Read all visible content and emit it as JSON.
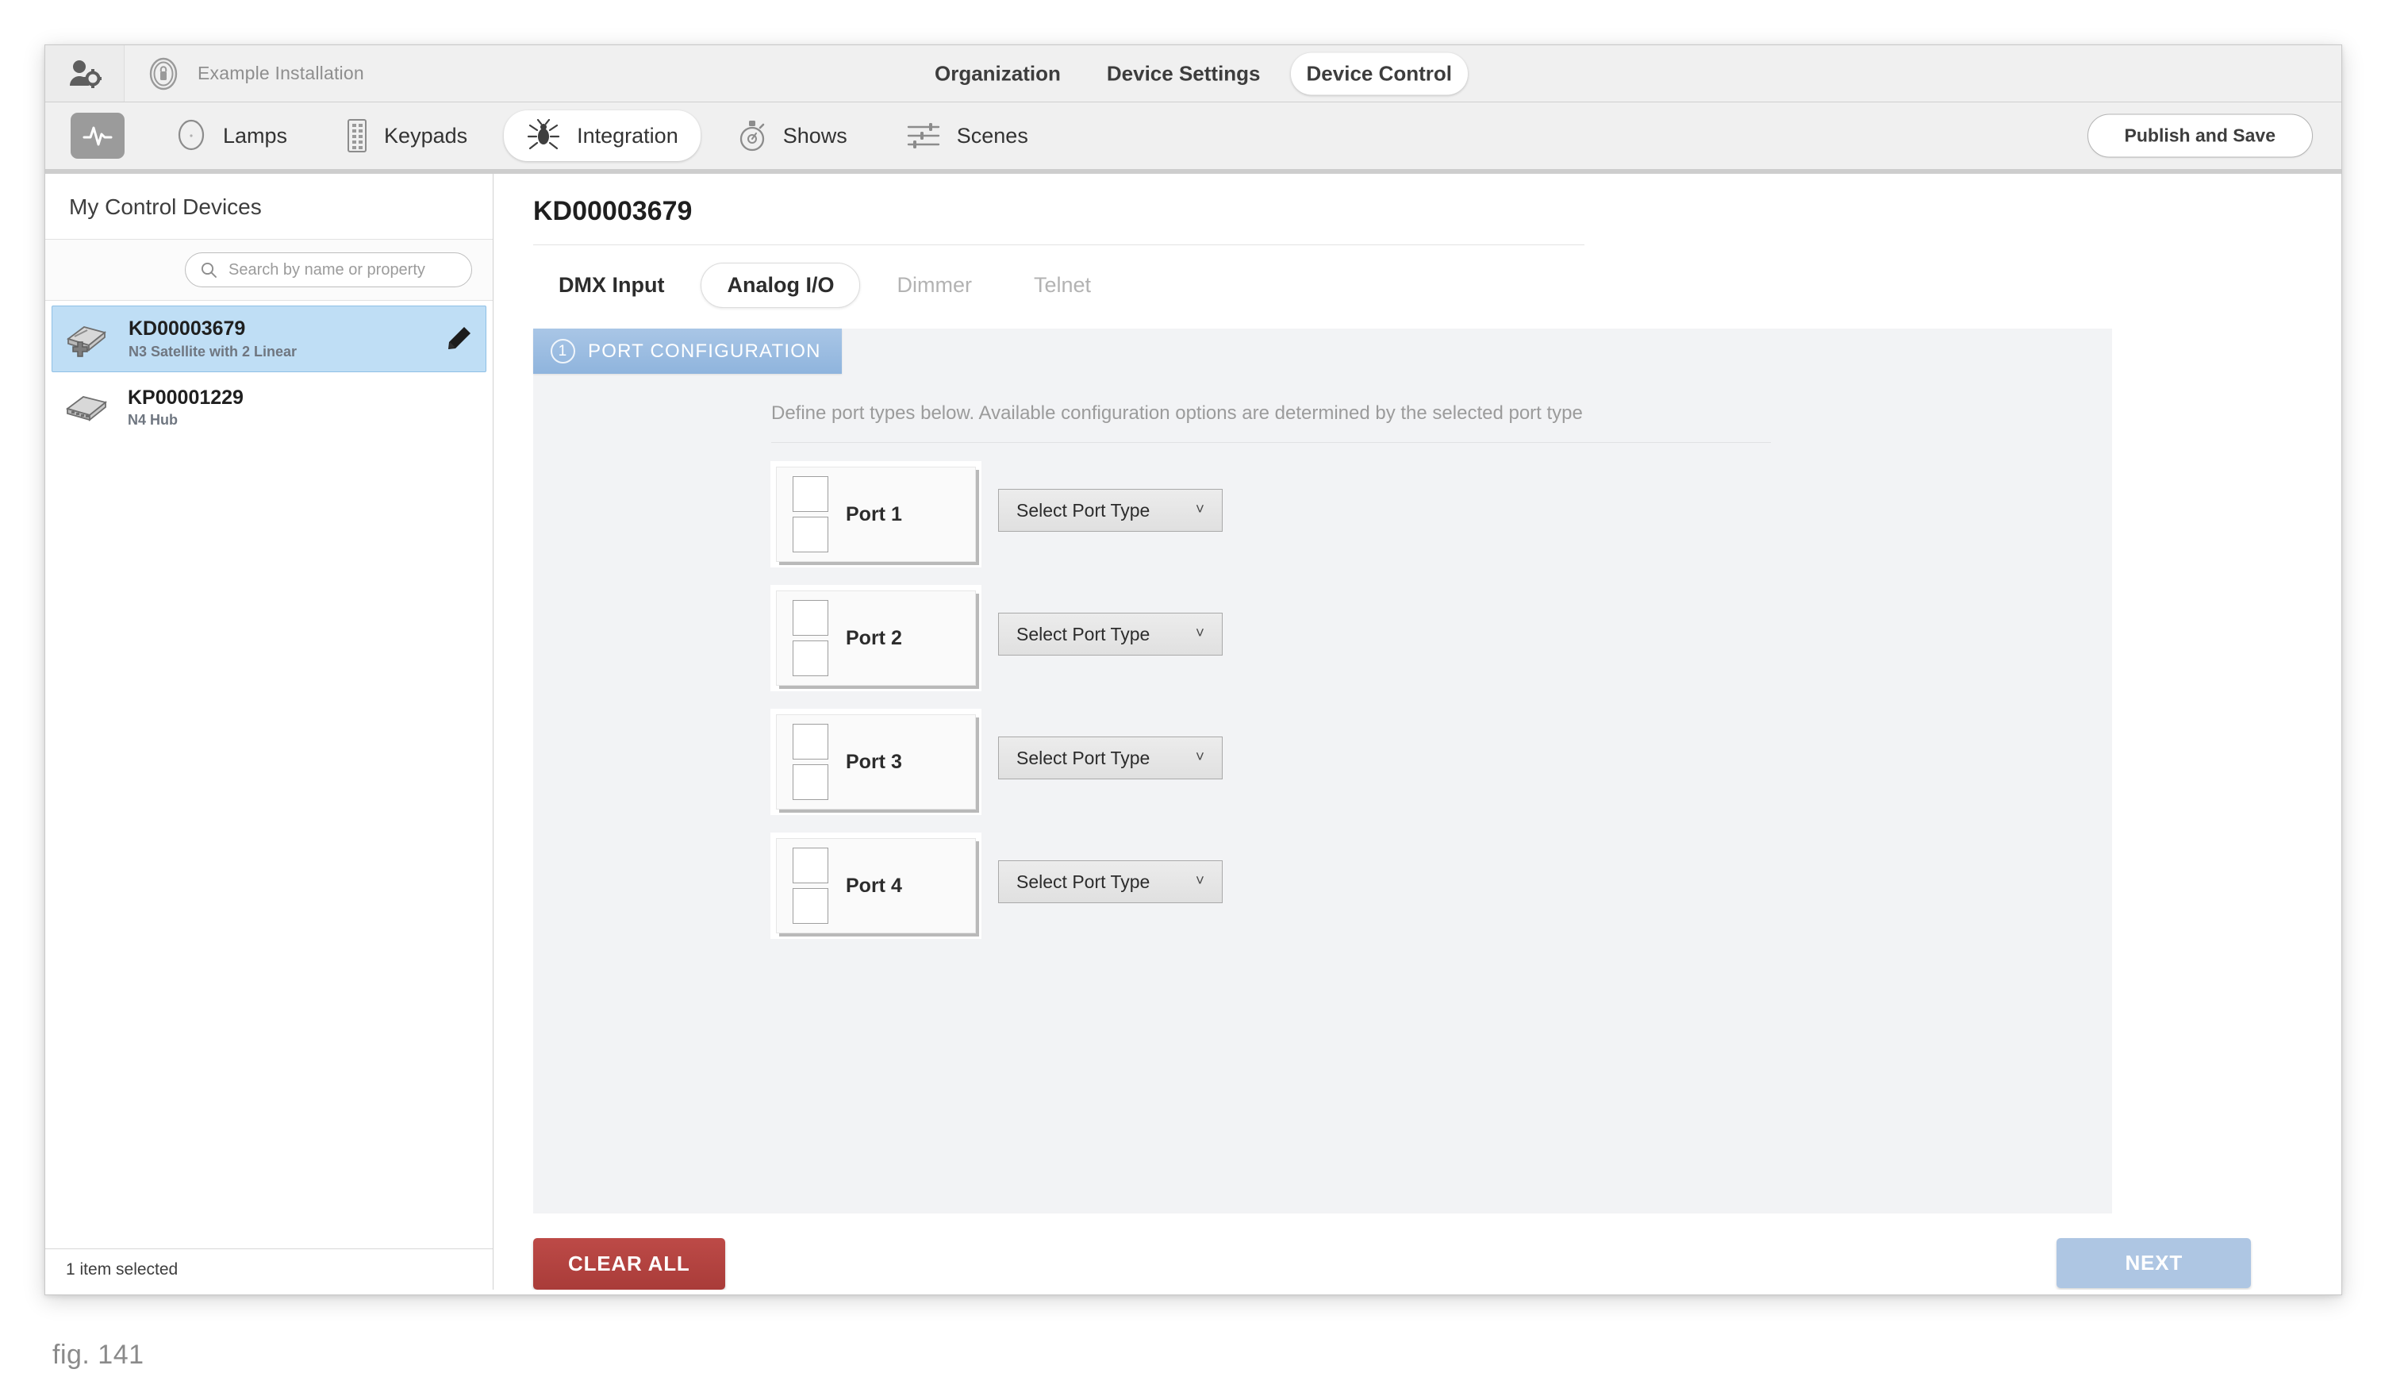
{
  "topbar": {
    "user_icon": "user-settings-icon",
    "installation_icon": "building-lock-icon",
    "installation_name": "Example Installation",
    "nav": [
      {
        "label": "Organization",
        "active": false
      },
      {
        "label": "Device Settings",
        "active": false
      },
      {
        "label": "Device Control",
        "active": true
      }
    ]
  },
  "toolbar": {
    "pulse_icon": "activity-pulse-icon",
    "items": [
      {
        "label": "Lamps",
        "icon": "lamp-circle-icon",
        "active": false
      },
      {
        "label": "Keypads",
        "icon": "keypad-icon",
        "active": false
      },
      {
        "label": "Integration",
        "icon": "integration-bug-icon",
        "active": true
      },
      {
        "label": "Shows",
        "icon": "stopwatch-icon",
        "active": false
      },
      {
        "label": "Scenes",
        "icon": "sliders-icon",
        "active": false
      }
    ],
    "publish_label": "Publish and Save"
  },
  "sidebar": {
    "title": "My Control Devices",
    "search": {
      "placeholder": "Search by name or property",
      "value": ""
    },
    "devices": [
      {
        "name": "KD00003679",
        "subtitle": "N3 Satellite with 2 Linear",
        "selected": true,
        "edit_icon": "pencil-icon"
      },
      {
        "name": "KP00001229",
        "subtitle": "N4 Hub",
        "selected": false
      }
    ],
    "status": "1 item selected"
  },
  "main": {
    "title": "KD00003679",
    "tabs": [
      {
        "label": "DMX Input",
        "active": false,
        "disabled": false
      },
      {
        "label": "Analog I/O",
        "active": true,
        "disabled": false
      },
      {
        "label": "Dimmer",
        "active": false,
        "disabled": true
      },
      {
        "label": "Telnet",
        "active": false,
        "disabled": true
      }
    ],
    "wizard": {
      "step_number": "1",
      "step_title": "PORT CONFIGURATION",
      "description": "Define port types below. Available configuration options are determined by the selected port type",
      "ports": [
        {
          "label": "Port 1",
          "select_value": "Select Port Type"
        },
        {
          "label": "Port 2",
          "select_value": "Select Port Type"
        },
        {
          "label": "Port 3",
          "select_value": "Select Port Type"
        },
        {
          "label": "Port 4",
          "select_value": "Select Port Type"
        }
      ],
      "clear_label": "CLEAR ALL",
      "next_label": "NEXT"
    }
  },
  "caption": "fig. 141",
  "colors": {
    "accent_blue": "#8fb4dd",
    "selection_blue": "#bfdef5",
    "danger_red": "#a93c39",
    "next_blue": "#aec6e3"
  }
}
